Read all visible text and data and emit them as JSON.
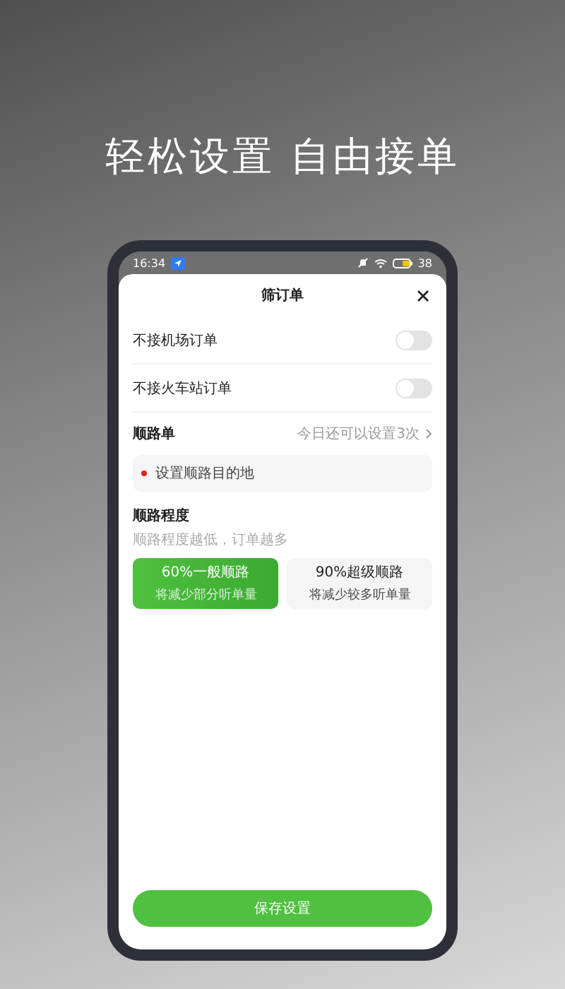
{
  "headline": "轻松设置 自由接单",
  "status_bar": {
    "time": "16:34",
    "battery": "38"
  },
  "sheet": {
    "title": "筛订单",
    "toggles": [
      {
        "label": "不接机场订单",
        "on": false
      },
      {
        "label": "不接火车站订单",
        "on": false
      }
    ],
    "route": {
      "title": "顺路单",
      "hint": "今日还可以设置3次",
      "destination": "设置顺路目的地"
    },
    "degree": {
      "title": "顺路程度",
      "subtitle": "顺路程度越低，订单越多",
      "options": [
        {
          "label": "60%一般顺路",
          "note": "将减少部分听单量",
          "selected": true
        },
        {
          "label": "90%超级顺路",
          "note": "将减少较多听单量",
          "selected": false
        }
      ]
    },
    "save_button": "保存设置"
  }
}
